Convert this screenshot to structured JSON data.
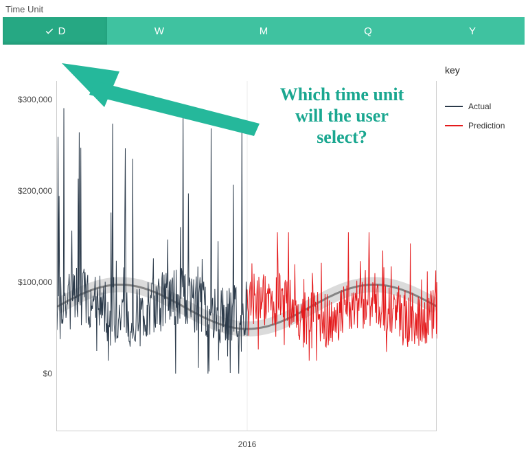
{
  "section_label": "Time Unit",
  "tabs": [
    {
      "label": "D",
      "active": true
    },
    {
      "label": "W",
      "active": false
    },
    {
      "label": "M",
      "active": false
    },
    {
      "label": "Q",
      "active": false
    },
    {
      "label": "Y",
      "active": false
    }
  ],
  "legend": {
    "title": "key",
    "items": [
      {
        "name": "Actual",
        "color": "#2b3a4a"
      },
      {
        "name": "Prediction",
        "color": "#e41a1c"
      }
    ]
  },
  "annotation_lines": [
    "Which time unit",
    "will the user",
    "select?"
  ],
  "chart_data": {
    "type": "line",
    "title": "",
    "xlabel": "",
    "ylabel": "",
    "ylim": [
      0,
      320000
    ],
    "yticks": [
      "$0",
      "$100,000",
      "$200,000",
      "$300,000"
    ],
    "xticks": [
      "2016"
    ],
    "x_range_days": 730,
    "series": [
      {
        "name": "Actual",
        "color": "#2b3a4a",
        "description": "Daily actual values for ~365 days (first half of x-axis), highly volatile between $0 and $310,000, centered around $70,000-$90,000 with large spikes.",
        "approx_mean": 78000,
        "approx_min": 0,
        "approx_max": 310000,
        "span_fraction": [
          0.0,
          0.5
        ]
      },
      {
        "name": "Prediction",
        "color": "#e41a1c",
        "description": "Daily predicted values for next ~365 days (second half of x-axis), volatile between $15,000 and $165,000, centered around $70,000-$85,000.",
        "approx_mean": 75000,
        "approx_min": 15000,
        "approx_max": 165000,
        "span_fraction": [
          0.5,
          1.0
        ]
      },
      {
        "name": "Trend",
        "color": "#888888",
        "description": "Smoothed/interval trend line with thick gray band across entire x-range, oscillating gently between ~$55,000 and ~$115,000 with roughly 3 humps over the year of actuals and continuing flatter through predictions.",
        "approx_mean": 78000,
        "approx_min": 55000,
        "approx_max": 115000,
        "span_fraction": [
          0.0,
          1.0
        ]
      }
    ]
  }
}
